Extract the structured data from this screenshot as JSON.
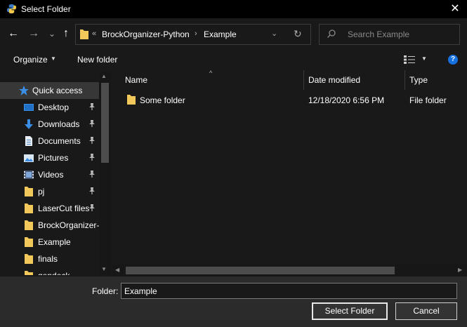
{
  "window": {
    "title": "Select Folder",
    "close_glyph": "✕"
  },
  "nav": {
    "back_glyph": "←",
    "forward_glyph": "→",
    "recent_glyph": "⌄",
    "up_glyph": "↑",
    "overflow": "«",
    "breadcrumbs": [
      "BrockOrganizer-Python",
      "Example"
    ],
    "separator": "›",
    "dropdown_glyph": "⌄",
    "refresh_glyph": "↻"
  },
  "search": {
    "placeholder": "Search Example"
  },
  "toolbar": {
    "organize_label": "Organize",
    "new_folder_label": "New folder",
    "caret": "▼",
    "help_label": "?"
  },
  "sidebar": {
    "items": [
      {
        "label": "Quick access",
        "icon": "star-icon",
        "pinned": false,
        "selected": true
      },
      {
        "label": "Desktop",
        "icon": "desktop-icon",
        "pinned": true
      },
      {
        "label": "Downloads",
        "icon": "download-icon",
        "pinned": true
      },
      {
        "label": "Documents",
        "icon": "document-icon",
        "pinned": true
      },
      {
        "label": "Pictures",
        "icon": "pictures-icon",
        "pinned": true
      },
      {
        "label": "Videos",
        "icon": "videos-icon",
        "pinned": true
      },
      {
        "label": "pj",
        "icon": "folder-icon",
        "pinned": true
      },
      {
        "label": "LaserCut files",
        "icon": "folder-icon",
        "pinned": true
      },
      {
        "label": "BrockOrganizer-",
        "icon": "folder-icon",
        "pinned": false
      },
      {
        "label": "Example",
        "icon": "folder-icon",
        "pinned": false
      },
      {
        "label": "finals",
        "icon": "folder-icon",
        "pinned": false
      },
      {
        "label": "gendeck",
        "icon": "folder-icon",
        "pinned": false
      }
    ]
  },
  "filelist": {
    "columns": {
      "name": "Name",
      "date": "Date modified",
      "type": "Type"
    },
    "sort_arrow": "^",
    "rows": [
      {
        "name": "Some folder",
        "date": "12/18/2020 6:56 PM",
        "type": "File folder"
      }
    ]
  },
  "footer": {
    "folder_label": "Folder:",
    "folder_value": "Example",
    "select_label": "Select Folder",
    "cancel_label": "Cancel"
  },
  "colors": {
    "accent": "#1570e0",
    "folder": "#f3c85a",
    "background": "#191919"
  }
}
